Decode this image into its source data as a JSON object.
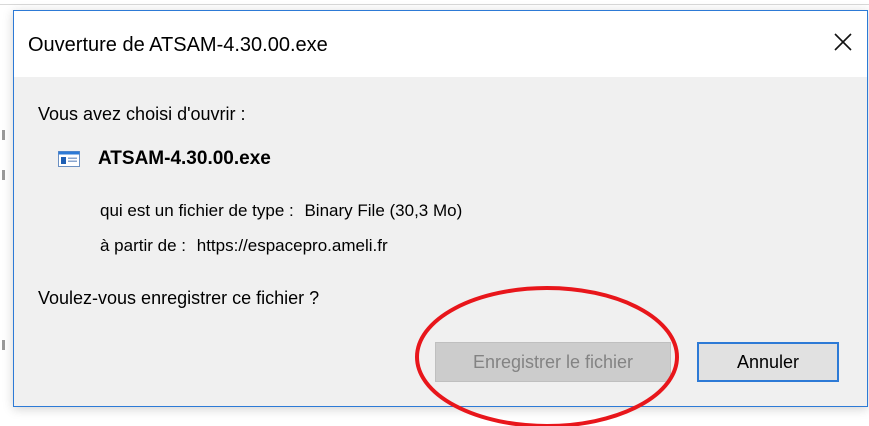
{
  "dialog": {
    "title": "Ouverture de ATSAM-4.30.00.exe",
    "close_icon": "close-icon",
    "accent_color": "#2d7ad6",
    "prompt_open": "Vous avez choisi d'ouvrir :",
    "file": {
      "icon": "executable-file-icon",
      "name": "ATSAM-4.30.00.exe"
    },
    "type_label": "qui est un fichier de type :",
    "type_value": "Binary File (30,3 Mo)",
    "from_label": "à partir de :",
    "from_value": "https://espacepro.ameli.fr",
    "question": "Voulez-vous enregistrer ce fichier ?",
    "buttons": {
      "save_label": "Enregistrer le fichier",
      "save_state": "disabled",
      "cancel_label": "Annuler"
    }
  },
  "annotation": {
    "shape": "ellipse",
    "color": "#e8161b",
    "target": "save-file-button"
  }
}
